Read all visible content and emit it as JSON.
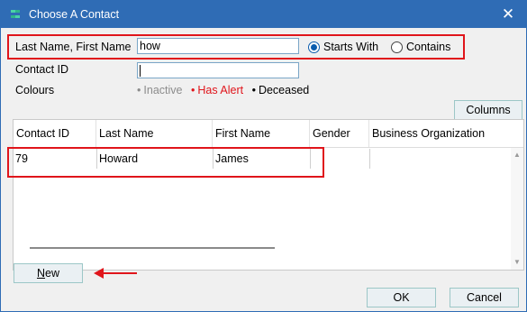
{
  "window": {
    "title": "Choose A Contact",
    "close_label": "✕"
  },
  "search": {
    "name_label": "Last Name, First Name",
    "name_value": "how",
    "match_options": [
      {
        "label": "Starts With",
        "checked": true
      },
      {
        "label": "Contains",
        "checked": false
      }
    ],
    "contact_id_label": "Contact ID",
    "contact_id_value": "",
    "colours_label": "Colours",
    "colours_legend": [
      {
        "dot": "•",
        "label": "Inactive",
        "color": "#8c8c8c"
      },
      {
        "dot": "•",
        "label": "Has Alert",
        "color": "#e0151b"
      },
      {
        "dot": "•",
        "label": "Deceased",
        "color": "#000000"
      }
    ]
  },
  "toolbar": {
    "columns_label": "Columns"
  },
  "table": {
    "columns": [
      "Contact ID",
      "Last Name",
      "First Name",
      "Gender",
      "Business Organization"
    ],
    "rows": [
      {
        "contact_id": "79",
        "last_name": "Howard",
        "first_name": "James",
        "gender": "",
        "business_organization": ""
      }
    ]
  },
  "footer": {
    "new_label_underlined": "N",
    "new_label_rest": "ew",
    "ok_label": "OK",
    "cancel_label": "Cancel"
  },
  "colors": {
    "titlebar": "#2f6cb5",
    "annotation": "#e0151b",
    "radio_selected": "#0b5cad"
  },
  "icons": {
    "app": "contact-app-icon",
    "close": "close-icon",
    "annotation_arrow": "arrow-left-icon"
  }
}
